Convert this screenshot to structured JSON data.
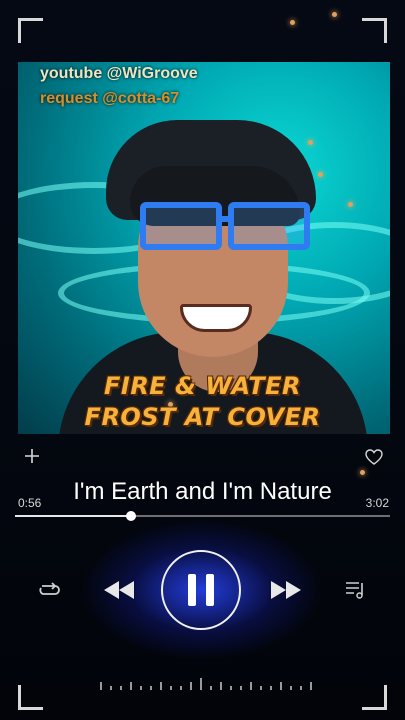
{
  "overlay": {
    "line1": "youtube @WiGroove",
    "line2": "request @cotta-67"
  },
  "album": {
    "title_line1": "FIRE & WATER",
    "title_line2": "FROST AT COVER"
  },
  "song": {
    "title": "I'm Earth and I'm Nature",
    "elapsed": "0:56",
    "duration": "3:02",
    "progress": 0.31
  },
  "icons": {
    "add": "plus-icon",
    "favorite": "heart-icon",
    "repeat": "repeat-icon",
    "previous": "rewind-icon",
    "play_pause": "pause-icon",
    "next": "fast-forward-icon",
    "queue": "queue-music-icon"
  },
  "colors": {
    "accent": "#2c44ff",
    "album_text": "#f7b23b"
  }
}
